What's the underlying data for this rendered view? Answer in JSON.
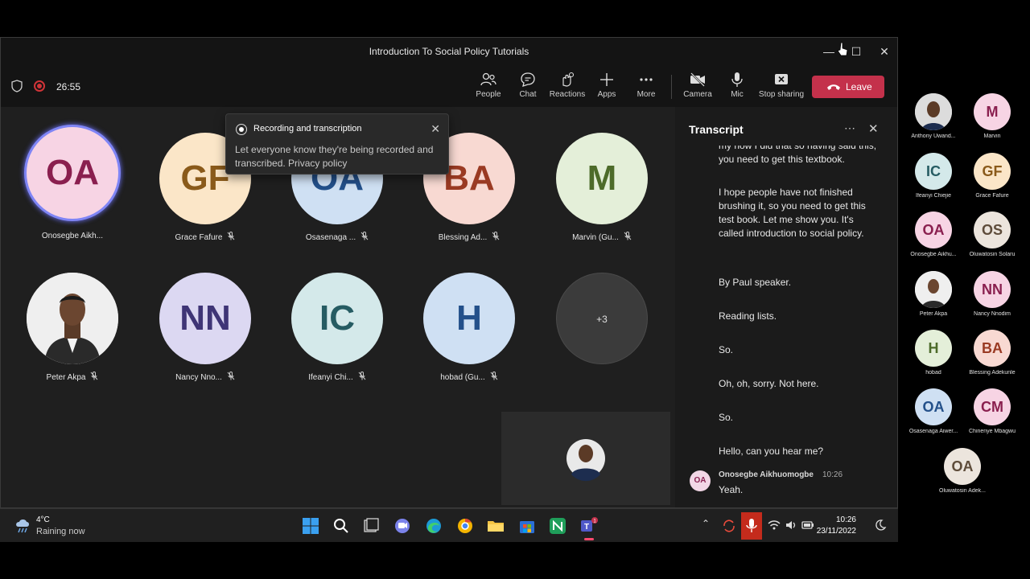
{
  "window": {
    "title": "Introduction To Social Policy Tutorials"
  },
  "toolbar": {
    "timer": "26:55",
    "buttons": [
      {
        "label": "People",
        "icon": "people-icon"
      },
      {
        "label": "Chat",
        "icon": "chat-icon"
      },
      {
        "label": "Reactions",
        "icon": "reactions-icon"
      },
      {
        "label": "Apps",
        "icon": "plus-icon"
      },
      {
        "label": "More",
        "icon": "more-icon"
      },
      {
        "label": "Camera",
        "icon": "camera-off-icon"
      },
      {
        "label": "Mic",
        "icon": "mic-icon"
      },
      {
        "label": "Stop sharing",
        "icon": "stop-sharing-icon"
      }
    ],
    "leave_label": "Leave"
  },
  "notification": {
    "title": "Recording and transcription",
    "body": "Let everyone know they're being recorded and transcribed. Privacy policy"
  },
  "gallery": [
    {
      "initials": "OA",
      "name": "Onosegbe Aikh...",
      "muted": false,
      "bg": "#f7d4e4",
      "fg": "#8a1f4f"
    },
    {
      "initials": "GF",
      "name": "Grace Fafure",
      "muted": true,
      "bg": "#fbe6c8",
      "fg": "#8a5a1a"
    },
    {
      "initials": "OA",
      "name": "Osasenaga ...",
      "muted": true,
      "bg": "#cfe0f3",
      "fg": "#23508a"
    },
    {
      "initials": "BA",
      "name": "Blessing Ad...",
      "muted": true,
      "bg": "#f8d9d2",
      "fg": "#9a3a23"
    },
    {
      "initials": "M",
      "name": "Marvin (Gu...",
      "muted": true,
      "bg": "#e4efd9",
      "fg": "#4d6b2a"
    },
    {
      "initials": "",
      "name": "Peter Akpa",
      "muted": true,
      "bg": "#e8e8e8",
      "fg": "#333"
    },
    {
      "initials": "NN",
      "name": "Nancy Nno...",
      "muted": true,
      "bg": "#dcd8f2",
      "fg": "#3f3576"
    },
    {
      "initials": "IC",
      "name": "Ifeanyi Chi...",
      "muted": true,
      "bg": "#d4e9ea",
      "fg": "#265c63"
    },
    {
      "initials": "H",
      "name": "hobad (Gu...",
      "muted": true,
      "bg": "#cfe0f3",
      "fg": "#23508a"
    },
    {
      "initials": "+3",
      "name": "",
      "muted": false,
      "bg": "#3b3b3b",
      "fg": "#e0e0e0"
    }
  ],
  "transcript": {
    "title": "Transcript",
    "lines": [
      "my now I did that so having said this, you need to get this textbook.",
      "I hope people have not finished brushing it, so you need to get this test book. Let me show you. It's called introduction to social policy.",
      "By Paul speaker.",
      "Reading lists.",
      "So.",
      "Oh, oh, sorry. Not here.",
      "So.",
      "Hello, can you hear me?"
    ],
    "speaker_initials": "OA",
    "speaker": "Onosegbe Aikhuomogbe",
    "time": "10:26",
    "last_line": "Yeah."
  },
  "taskbar": {
    "temperature": "4°C",
    "condition": "Raining now",
    "time": "10:26",
    "date": "23/11/2022"
  },
  "participants": [
    {
      "initials": "",
      "name": "Anthony Uwand...",
      "bg": "#d9d9d9",
      "fg": "#333"
    },
    {
      "initials": "M",
      "name": "Marvin",
      "bg": "#f7d4e4",
      "fg": "#8a1f4f"
    },
    {
      "initials": "IC",
      "name": "Ifeanyi Chiejie",
      "bg": "#d4e9ea",
      "fg": "#265c63"
    },
    {
      "initials": "GF",
      "name": "Grace Fafure",
      "bg": "#fbe6c8",
      "fg": "#8a5a1a"
    },
    {
      "initials": "OA",
      "name": "Onosegbe Aikhu...",
      "bg": "#f7d4e4",
      "fg": "#8a1f4f"
    },
    {
      "initials": "OS",
      "name": "Oluwatosin Solaru",
      "bg": "#ece5dd",
      "fg": "#5e4c3a"
    },
    {
      "initials": "",
      "name": "Peter Akpa",
      "bg": "#d9d9d9",
      "fg": "#333"
    },
    {
      "initials": "NN",
      "name": "Nancy Nnodim",
      "bg": "#f7d4e4",
      "fg": "#8a1f4f"
    },
    {
      "initials": "H",
      "name": "hobad",
      "bg": "#e4efd9",
      "fg": "#4d6b2a"
    },
    {
      "initials": "BA",
      "name": "Blessing Adekunle",
      "bg": "#f8d9d2",
      "fg": "#9a3a23"
    },
    {
      "initials": "OA",
      "name": "Osasenaga Aiwer...",
      "bg": "#cfe0f3",
      "fg": "#23508a"
    },
    {
      "initials": "CM",
      "name": "Chinenye Mbagwu",
      "bg": "#f7d4e4",
      "fg": "#8a1f4f"
    },
    {
      "initials": "OA",
      "name": "Oluwatosin Adek...",
      "bg": "#ece5dd",
      "fg": "#5e4c3a"
    }
  ]
}
